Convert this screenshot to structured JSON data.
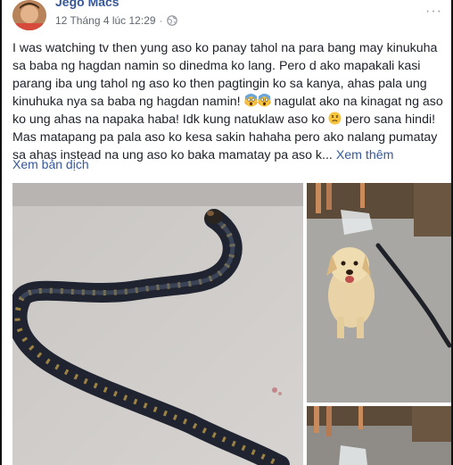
{
  "post": {
    "author": "Jego Macs",
    "timestamp": "12 Tháng 4 lúc 12:29",
    "separator": "·",
    "more_label": "···",
    "text": {
      "part1": "I was watching tv then yung aso ko panay tahol na para bang may kinukuha sa baba ng hagdan namin so dinedma ko lang. Pero d ako mapakali kasi parang iba ung tahol ng aso ko then pagtingin ko sa kanya, ahas pala ung kinuhuka nya sa baba ng hagdan namin! ",
      "part2": " nagulat ako na kinagat ng aso ko ung ahas na napaka haba! Idk kung natuklaw aso ko ",
      "part3": " pero sana hindi! Mas matapang pa pala aso ko kesa sakin hahaha pero ako nalang pumatay sa ahas instead na ung aso ko baka mamatay pa aso k...",
      "see_more": "Xem thêm"
    },
    "translate_label": "Xem bản dịch",
    "icons": {
      "privacy": "globe-icon",
      "emoji_shock": "face-screaming-in-fear-icon",
      "emoji_worried": "confused-face-icon"
    }
  }
}
